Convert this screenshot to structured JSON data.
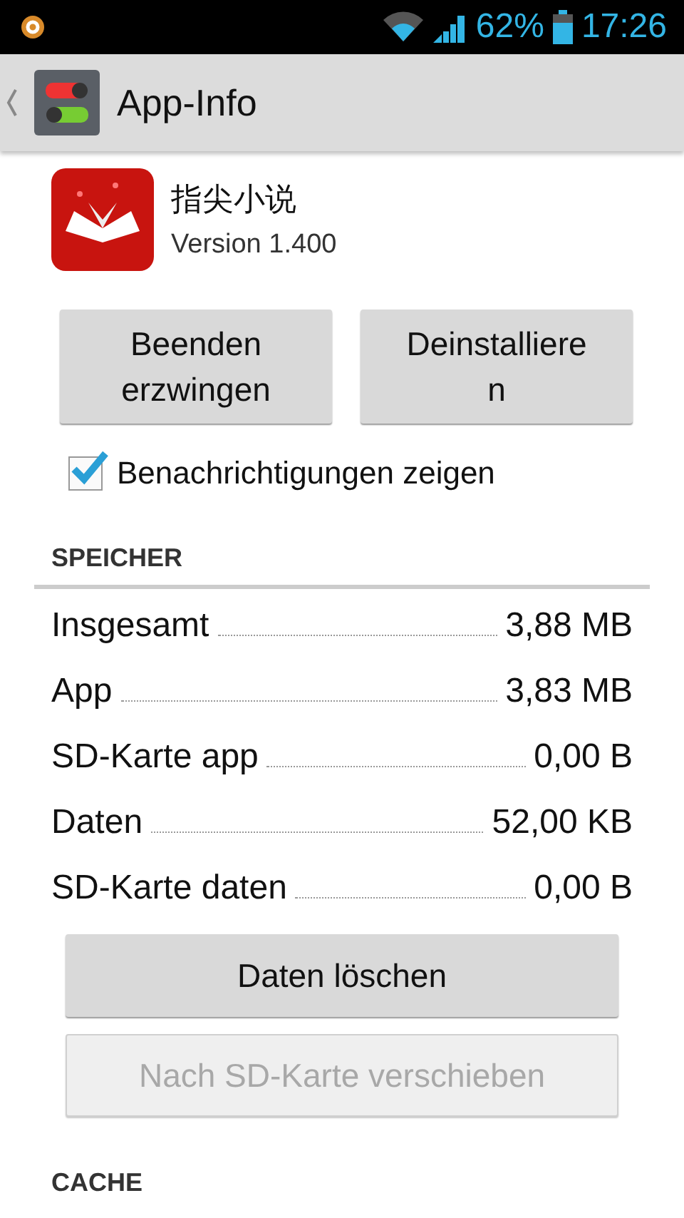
{
  "status_bar": {
    "battery": "62%",
    "time": "17:26"
  },
  "action_bar": {
    "title": "App-Info"
  },
  "app": {
    "name": "指尖小说",
    "version": "Version 1.400"
  },
  "actions": [
    {
      "label": "Beenden erzwingen",
      "disabled": false
    },
    {
      "label": "Deinstallieren",
      "disabled": false
    }
  ],
  "notifications": {
    "label": "Benachrichtigungen zeigen",
    "checked": true
  },
  "storage": {
    "heading": "SPEICHER",
    "rows": [
      {
        "label": "Insgesamt",
        "value": "3,88 MB"
      },
      {
        "label": "App",
        "value": "3,83 MB"
      },
      {
        "label": "SD-Karte app",
        "value": "0,00 B"
      },
      {
        "label": "Daten",
        "value": "52,00 KB"
      },
      {
        "label": "SD-Karte daten",
        "value": "0,00 B"
      }
    ],
    "buttons": [
      {
        "label": "Daten löschen",
        "disabled": false
      },
      {
        "label": "Nach SD-Karte verschieben",
        "disabled": true
      }
    ]
  },
  "cache": {
    "heading": "CACHE"
  }
}
